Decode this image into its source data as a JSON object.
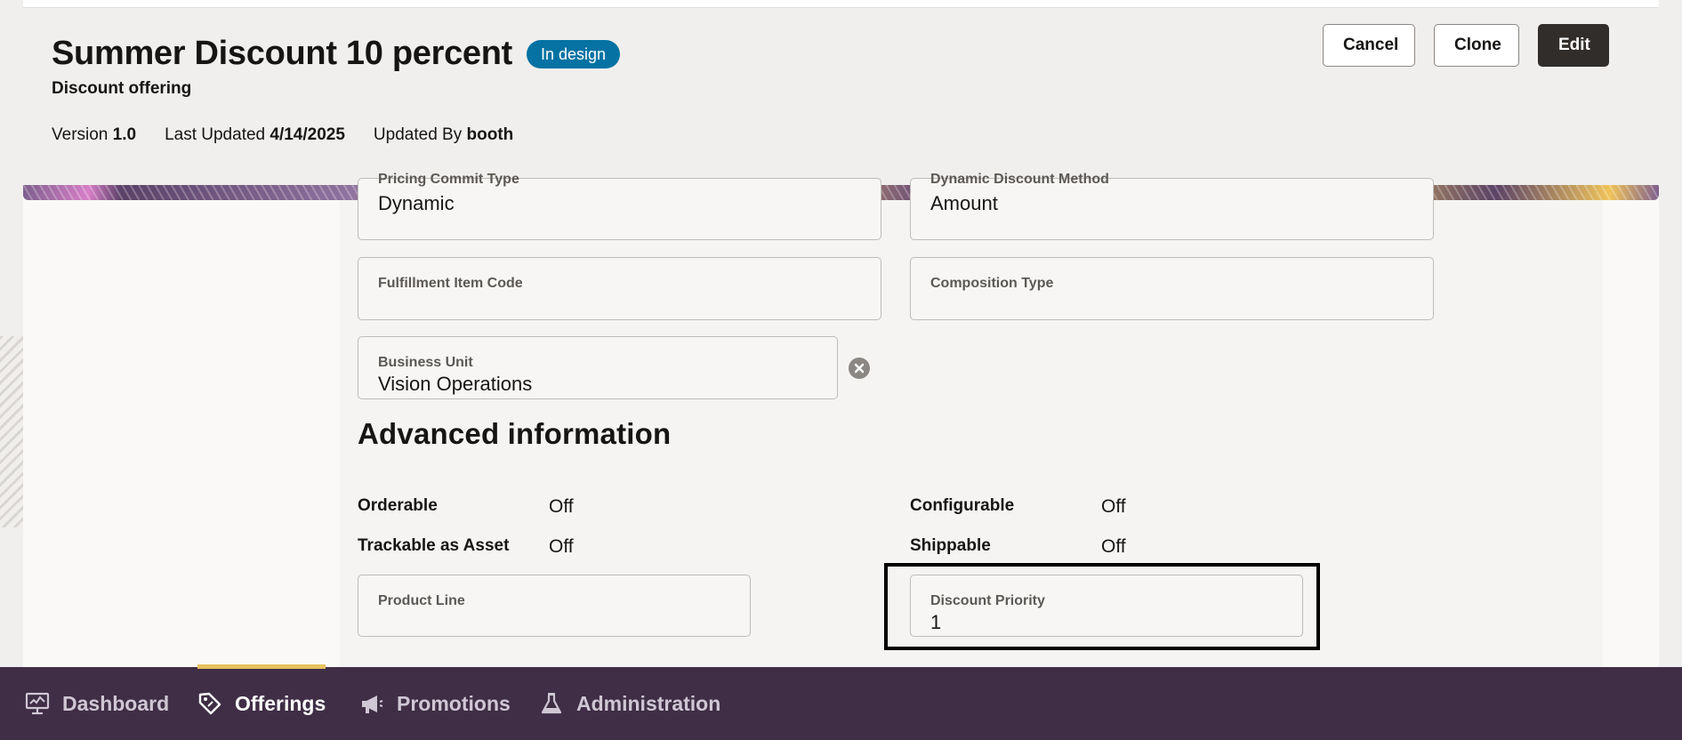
{
  "header": {
    "title": "Summer Discount 10 percent",
    "status": "In design",
    "subtitle": "Discount offering",
    "version_label": "Version",
    "version": "1.0",
    "last_updated_label": "Last Updated",
    "last_updated": "4/14/2025",
    "updated_by_label": "Updated By",
    "updated_by": "booth"
  },
  "actions": {
    "cancel": "Cancel",
    "clone": "Clone",
    "edit": "Edit"
  },
  "form": {
    "pricing_commit_type": {
      "label": "Pricing Commit Type",
      "value": "Dynamic"
    },
    "dynamic_discount_method": {
      "label": "Dynamic Discount Method",
      "value": "Amount"
    },
    "fulfillment_item_code": {
      "label": "Fulfillment Item Code",
      "value": ""
    },
    "composition_type": {
      "label": "Composition Type",
      "value": ""
    },
    "business_unit": {
      "label": "Business Unit",
      "value": "Vision Operations"
    },
    "product_line": {
      "label": "Product Line",
      "value": ""
    },
    "discount_priority": {
      "label": "Discount Priority",
      "value": "1"
    }
  },
  "advanced": {
    "title": "Advanced information",
    "orderable": {
      "label": "Orderable",
      "value": "Off"
    },
    "configurable": {
      "label": "Configurable",
      "value": "Off"
    },
    "trackable": {
      "label": "Trackable as Asset",
      "value": "Off"
    },
    "shippable": {
      "label": "Shippable",
      "value": "Off"
    }
  },
  "nav": {
    "items": [
      {
        "label": "Dashboard",
        "icon": "dashboard-icon"
      },
      {
        "label": "Offerings",
        "icon": "tag-icon",
        "active": true
      },
      {
        "label": "Promotions",
        "icon": "megaphone-icon"
      },
      {
        "label": "Administration",
        "icon": "flask-icon"
      }
    ]
  },
  "colors": {
    "badge": "#0572a3",
    "nav_bg": "#3f2e46",
    "nav_active_bar": "#e8c15f",
    "edit_button": "#312d2a"
  }
}
